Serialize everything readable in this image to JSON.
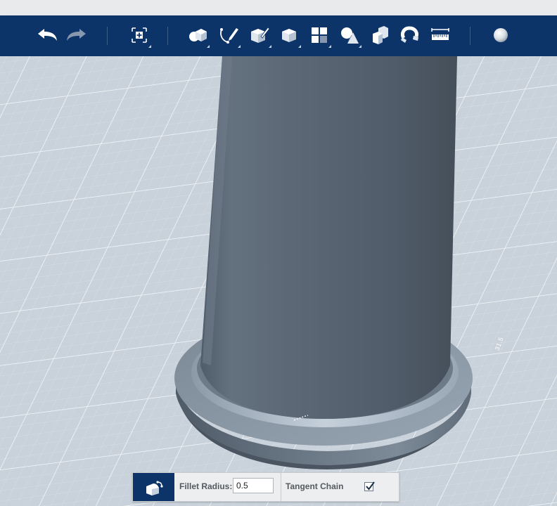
{
  "toolbar": {
    "items": [
      {
        "id": "undo",
        "icon": "undo-icon"
      },
      {
        "id": "redo",
        "icon": "redo-icon"
      },
      {
        "id": "transform",
        "icon": "transform-icon"
      },
      {
        "id": "primitives",
        "icon": "primitives-icon"
      },
      {
        "id": "sketch",
        "icon": "sketch-icon"
      },
      {
        "id": "construct",
        "icon": "construct-icon"
      },
      {
        "id": "modify",
        "icon": "modify-icon"
      },
      {
        "id": "pattern",
        "icon": "pattern-icon"
      },
      {
        "id": "combine",
        "icon": "combine-icon"
      },
      {
        "id": "group",
        "icon": "group-icon"
      },
      {
        "id": "snap",
        "icon": "snap-icon"
      },
      {
        "id": "measure",
        "icon": "measure-icon"
      },
      {
        "id": "material",
        "icon": "material-icon"
      }
    ]
  },
  "viewport": {
    "grid_dimension": "31.5"
  },
  "fillet": {
    "radius_label": "Fillet Radius:",
    "radius_value": "0.5",
    "tangent_label": "Tangent Chain",
    "tangent_checked": true
  },
  "colors": {
    "toolbar": "#0c3468",
    "grid_background": "#c9d1da",
    "model": "#5d6b79"
  }
}
